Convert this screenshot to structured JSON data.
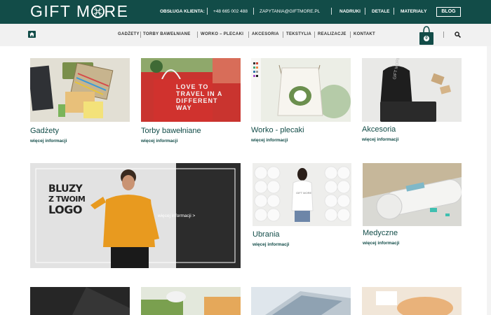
{
  "header": {
    "logo_part1": "GIFT M",
    "logo_part2": "RE",
    "support_label": "OBSŁUGA KLIENTA:",
    "phone": "+48 665 002 488",
    "email": "ZAPYTANIA@GIFTMORE.PL",
    "links": [
      "NADRUKI",
      "DETALE",
      "MATERIAŁY"
    ],
    "blog_label": "BLOG"
  },
  "nav": {
    "items": [
      "GADŻETY",
      "TORBY BAWEŁNIANE",
      "WORKO – PLECAKI",
      "AKCESORIA",
      "TEKSTYLIA",
      "REALIZACJE",
      "KONTAKT"
    ],
    "cart_count": "0"
  },
  "categories": [
    {
      "title": "Gadżety",
      "more": "więcej informacji"
    },
    {
      "title": "Torby bawełniane",
      "more": "więcej informacji"
    },
    {
      "title": "Worko - plecaki",
      "more": "więcej informacji"
    },
    {
      "title": "Akcesoria",
      "more": "więcej informacji"
    },
    {
      "title": "Ubrania",
      "more": "więcej informacji"
    },
    {
      "title": "Medyczne",
      "more": "więcej informacji"
    }
  ],
  "banner": {
    "line1": "BLUZY",
    "line2": "Z TWOIM",
    "line3": "LOGO",
    "more": "więcej informacji >"
  },
  "photo_text": {
    "tote": "LOVE TO TRAVEL IN A DIFFERENT WAY",
    "shirt": "GIFT MORE",
    "sack": "GIFT MORE"
  },
  "colors": {
    "brand": "#124c48",
    "nav_bg": "#f1f1f1"
  }
}
